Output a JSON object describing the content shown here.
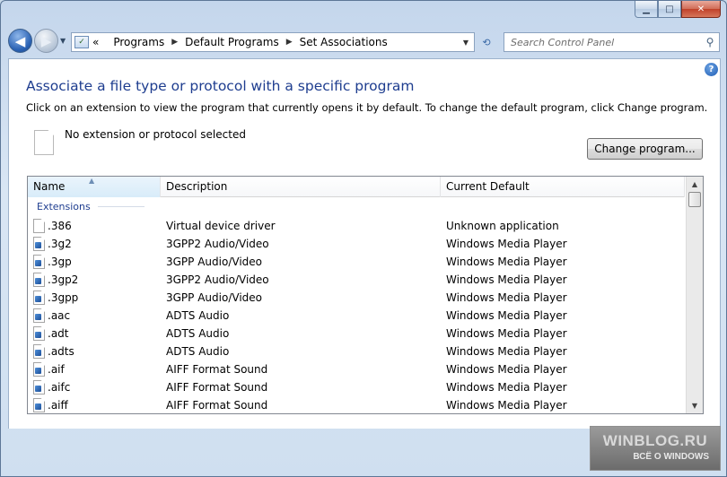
{
  "window": {
    "caption_buttons": {
      "minimize": "▁",
      "maximize": "□",
      "close": "✕"
    }
  },
  "nav": {
    "back_glyph": "◀",
    "forward_glyph": "▶",
    "breadcrumb": {
      "prefix": "«",
      "items": [
        "Programs",
        "Default Programs",
        "Set Associations"
      ]
    },
    "search_placeholder": "Search Control Panel"
  },
  "page": {
    "title": "Associate a file type or protocol with a specific program",
    "description": "Click on an extension to view the program that currently opens it by default. To change the default program, click Change program.",
    "selected_text": "No extension or protocol selected",
    "change_button_label": "Change program..."
  },
  "list": {
    "columns": [
      "Name",
      "Description",
      "Current Default"
    ],
    "group_label": "Extensions",
    "rows": [
      {
        "name": ".386",
        "description": "Virtual device driver",
        "default": "Unknown application",
        "icon": "blank-file-icon"
      },
      {
        "name": ".3g2",
        "description": "3GPP2 Audio/Video",
        "default": "Windows Media Player",
        "icon": "media-file-icon"
      },
      {
        "name": ".3gp",
        "description": "3GPP Audio/Video",
        "default": "Windows Media Player",
        "icon": "media-file-icon"
      },
      {
        "name": ".3gp2",
        "description": "3GPP2 Audio/Video",
        "default": "Windows Media Player",
        "icon": "media-file-icon"
      },
      {
        "name": ".3gpp",
        "description": "3GPP Audio/Video",
        "default": "Windows Media Player",
        "icon": "media-file-icon"
      },
      {
        "name": ".aac",
        "description": "ADTS Audio",
        "default": "Windows Media Player",
        "icon": "media-file-icon"
      },
      {
        "name": ".adt",
        "description": "ADTS Audio",
        "default": "Windows Media Player",
        "icon": "media-file-icon"
      },
      {
        "name": ".adts",
        "description": "ADTS Audio",
        "default": "Windows Media Player",
        "icon": "media-file-icon"
      },
      {
        "name": ".aif",
        "description": "AIFF Format Sound",
        "default": "Windows Media Player",
        "icon": "media-file-icon"
      },
      {
        "name": ".aifc",
        "description": "AIFF Format Sound",
        "default": "Windows Media Player",
        "icon": "media-file-icon"
      },
      {
        "name": ".aiff",
        "description": "AIFF Format Sound",
        "default": "Windows Media Player",
        "icon": "media-file-icon"
      }
    ]
  },
  "watermark": {
    "line1": "WINBLOG.RU",
    "line2": "ВСЁ О WINDOWS"
  },
  "colors": {
    "title": "#1e3d8f",
    "accent": "#2a62b4"
  }
}
